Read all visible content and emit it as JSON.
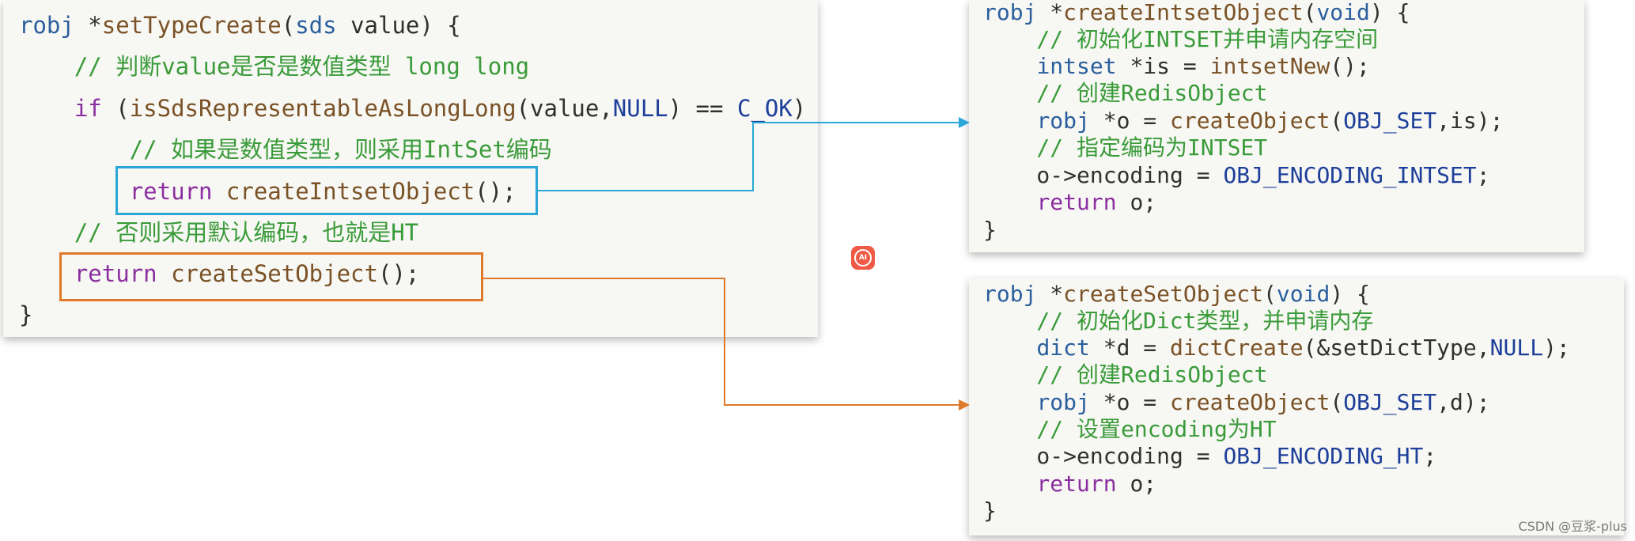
{
  "left": {
    "lines": [
      [
        {
          "t": "robj",
          "c": "kw-type"
        },
        {
          "t": " *",
          "c": "plain"
        },
        {
          "t": "setTypeCreate",
          "c": "fn"
        },
        {
          "t": "(",
          "c": "plain"
        },
        {
          "t": "sds",
          "c": "kw-type"
        },
        {
          "t": " value) {",
          "c": "plain"
        }
      ],
      [
        {
          "t": "    // 判断value是否是数值类型 long long",
          "c": "cmt"
        }
      ],
      [
        {
          "t": "    ",
          "c": "plain"
        },
        {
          "t": "if",
          "c": "kw-ctl"
        },
        {
          "t": " (",
          "c": "plain"
        },
        {
          "t": "isSdsRepresentableAsLongLong",
          "c": "fn"
        },
        {
          "t": "(value,",
          "c": "plain"
        },
        {
          "t": "NULL",
          "c": "const"
        },
        {
          "t": ") == ",
          "c": "plain"
        },
        {
          "t": "C_OK",
          "c": "const"
        },
        {
          "t": ")",
          "c": "plain"
        }
      ],
      [
        {
          "t": "        // 如果是数值类型，则采用IntSet编码",
          "c": "cmt"
        }
      ],
      [
        {
          "t": "        ",
          "c": "plain"
        },
        {
          "t": "return",
          "c": "kw-ctl"
        },
        {
          "t": " ",
          "c": "plain"
        },
        {
          "t": "createIntsetObject",
          "c": "fn"
        },
        {
          "t": "();",
          "c": "plain"
        }
      ],
      [
        {
          "t": "    // 否则采用默认编码，也就是HT",
          "c": "cmt"
        }
      ],
      [
        {
          "t": "    ",
          "c": "plain"
        },
        {
          "t": "return",
          "c": "kw-ctl"
        },
        {
          "t": " ",
          "c": "plain"
        },
        {
          "t": "createSetObject",
          "c": "fn"
        },
        {
          "t": "();",
          "c": "plain"
        }
      ],
      [
        {
          "t": "}",
          "c": "plain"
        }
      ]
    ]
  },
  "right_top": {
    "lines": [
      [
        {
          "t": "robj",
          "c": "kw-type"
        },
        {
          "t": " *",
          "c": "plain"
        },
        {
          "t": "createIntsetObject",
          "c": "fn"
        },
        {
          "t": "(",
          "c": "plain"
        },
        {
          "t": "void",
          "c": "kw-type"
        },
        {
          "t": ") {",
          "c": "plain"
        }
      ],
      [
        {
          "t": "    // 初始化INTSET并申请内存空间",
          "c": "cmt"
        }
      ],
      [
        {
          "t": "    ",
          "c": "plain"
        },
        {
          "t": "intset",
          "c": "kw-type"
        },
        {
          "t": " *is = ",
          "c": "plain"
        },
        {
          "t": "intsetNew",
          "c": "fn"
        },
        {
          "t": "();",
          "c": "plain"
        }
      ],
      [
        {
          "t": "    // 创建RedisObject",
          "c": "cmt"
        }
      ],
      [
        {
          "t": "    ",
          "c": "plain"
        },
        {
          "t": "robj",
          "c": "kw-type"
        },
        {
          "t": " *o = ",
          "c": "plain"
        },
        {
          "t": "createObject",
          "c": "fn"
        },
        {
          "t": "(",
          "c": "plain"
        },
        {
          "t": "OBJ_SET",
          "c": "const"
        },
        {
          "t": ",is);",
          "c": "plain"
        }
      ],
      [
        {
          "t": "    // 指定编码为INTSET",
          "c": "cmt"
        }
      ],
      [
        {
          "t": "    o->encoding = ",
          "c": "plain"
        },
        {
          "t": "OBJ_ENCODING_INTSET",
          "c": "const"
        },
        {
          "t": ";",
          "c": "plain"
        }
      ],
      [
        {
          "t": "    ",
          "c": "plain"
        },
        {
          "t": "return",
          "c": "kw-ctl"
        },
        {
          "t": " o;",
          "c": "plain"
        }
      ],
      [
        {
          "t": "}",
          "c": "plain"
        }
      ]
    ]
  },
  "right_bottom": {
    "lines": [
      [
        {
          "t": "robj",
          "c": "kw-type"
        },
        {
          "t": " *",
          "c": "plain"
        },
        {
          "t": "createSetObject",
          "c": "fn"
        },
        {
          "t": "(",
          "c": "plain"
        },
        {
          "t": "void",
          "c": "kw-type"
        },
        {
          "t": ") {",
          "c": "plain"
        }
      ],
      [
        {
          "t": "    // 初始化Dict类型，并申请内存",
          "c": "cmt"
        }
      ],
      [
        {
          "t": "    ",
          "c": "plain"
        },
        {
          "t": "dict",
          "c": "kw-type"
        },
        {
          "t": " *d = ",
          "c": "plain"
        },
        {
          "t": "dictCreate",
          "c": "fn"
        },
        {
          "t": "(&setDictType,",
          "c": "plain"
        },
        {
          "t": "NULL",
          "c": "const"
        },
        {
          "t": ");",
          "c": "plain"
        }
      ],
      [
        {
          "t": "    // 创建RedisObject",
          "c": "cmt"
        }
      ],
      [
        {
          "t": "    ",
          "c": "plain"
        },
        {
          "t": "robj",
          "c": "kw-type"
        },
        {
          "t": " *o = ",
          "c": "plain"
        },
        {
          "t": "createObject",
          "c": "fn"
        },
        {
          "t": "(",
          "c": "plain"
        },
        {
          "t": "OBJ_SET",
          "c": "const"
        },
        {
          "t": ",d);",
          "c": "plain"
        }
      ],
      [
        {
          "t": "    // 设置encoding为HT",
          "c": "cmt"
        }
      ],
      [
        {
          "t": "    o->encoding = ",
          "c": "plain"
        },
        {
          "t": "OBJ_ENCODING_HT",
          "c": "const"
        },
        {
          "t": ";",
          "c": "plain"
        }
      ],
      [
        {
          "t": "    ",
          "c": "plain"
        },
        {
          "t": "return",
          "c": "kw-ctl"
        },
        {
          "t": " o;",
          "c": "plain"
        }
      ],
      [
        {
          "t": "}",
          "c": "plain"
        }
      ]
    ]
  },
  "colors": {
    "intset_highlight": "#2aa7d8",
    "ht_highlight": "#e07a2a"
  },
  "watermark": "CSDN @豆浆-plus",
  "badge_icon": "ai-assistant-icon"
}
